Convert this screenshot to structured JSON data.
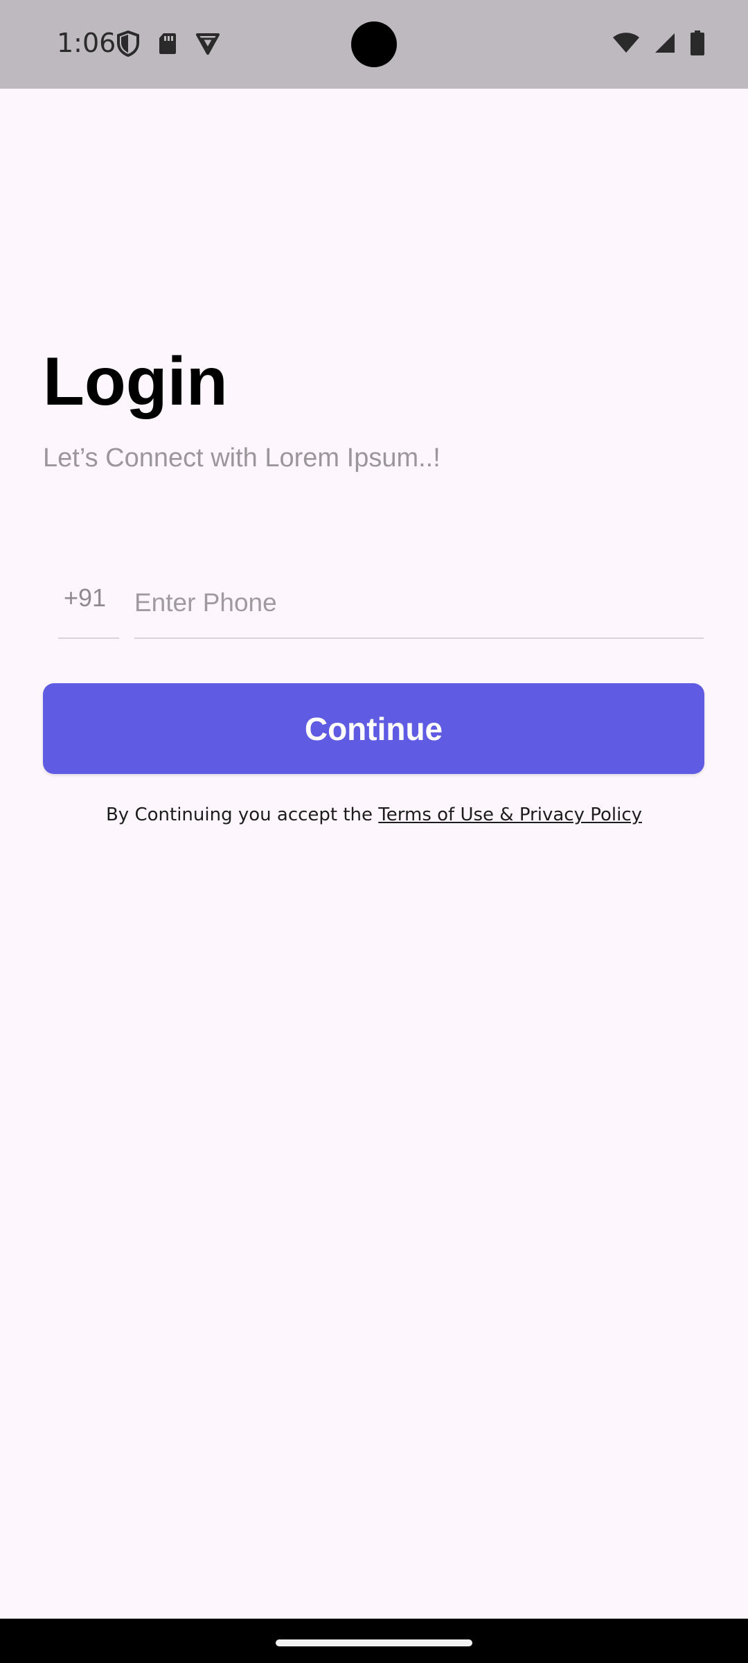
{
  "status_bar": {
    "time": "1:06",
    "left_icons": [
      "shield-icon",
      "sd-card-icon",
      "vpn-triangle-icon"
    ],
    "right_icons": [
      "wifi-icon",
      "signal-icon",
      "battery-icon"
    ]
  },
  "login": {
    "title": "Login",
    "subtitle": "Let’s Connect with Lorem Ipsum..!",
    "country_code": "+91",
    "phone_placeholder": "Enter Phone",
    "phone_value": "",
    "continue_label": "Continue",
    "terms_prefix": "By Continuing you accept the ",
    "terms_link": "Terms of Use & Privacy Policy"
  },
  "colors": {
    "background": "#FDF7FD",
    "status_bar": "#BDB9BE",
    "primary_button": "#5F5BE3",
    "subtitle_text": "#9A969A"
  }
}
